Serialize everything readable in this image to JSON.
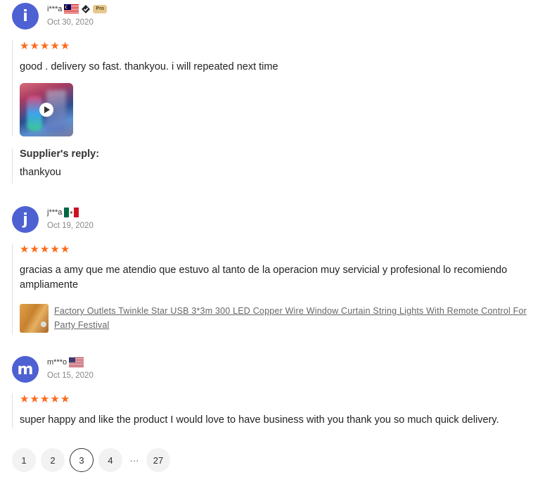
{
  "reviews": [
    {
      "avatar_letter": "i",
      "username": "i***a",
      "country_flag": "malaysia-flag",
      "pro_badge": "Pro",
      "date": "Oct 30, 2020",
      "rating": 5,
      "text": "good . delivery so fast. thankyou. i will repeated next time",
      "has_video": true,
      "supplier_reply": {
        "title": "Supplier's reply:",
        "text": "thankyou"
      }
    },
    {
      "avatar_letter": "j",
      "username": "j***a",
      "country_flag": "mexico-flag",
      "date": "Oct 19, 2020",
      "rating": 5,
      "text": "gracias a amy que me atendio que estuvo al tanto de la operacion muy servicial y profesional lo recomiendo ampliamente",
      "product_link": "Factory Outlets Twinkle Star USB 3*3m 300 LED Copper Wire Window Curtain String Lights With Remote Control For Party Festival"
    },
    {
      "avatar_letter": "m",
      "username": "m***o",
      "country_flag": "usa-flag",
      "date": "Oct 15, 2020",
      "rating": 5,
      "text": "super happy and like the product I would love to have business with you thank you so much quick delivery."
    }
  ],
  "pagination": {
    "pages": [
      "1",
      "2",
      "3",
      "4"
    ],
    "ellipsis": "···",
    "last": "27",
    "current": "3"
  },
  "colors": {
    "avatar": "#4d61d2",
    "star": "#fd6a1b"
  }
}
